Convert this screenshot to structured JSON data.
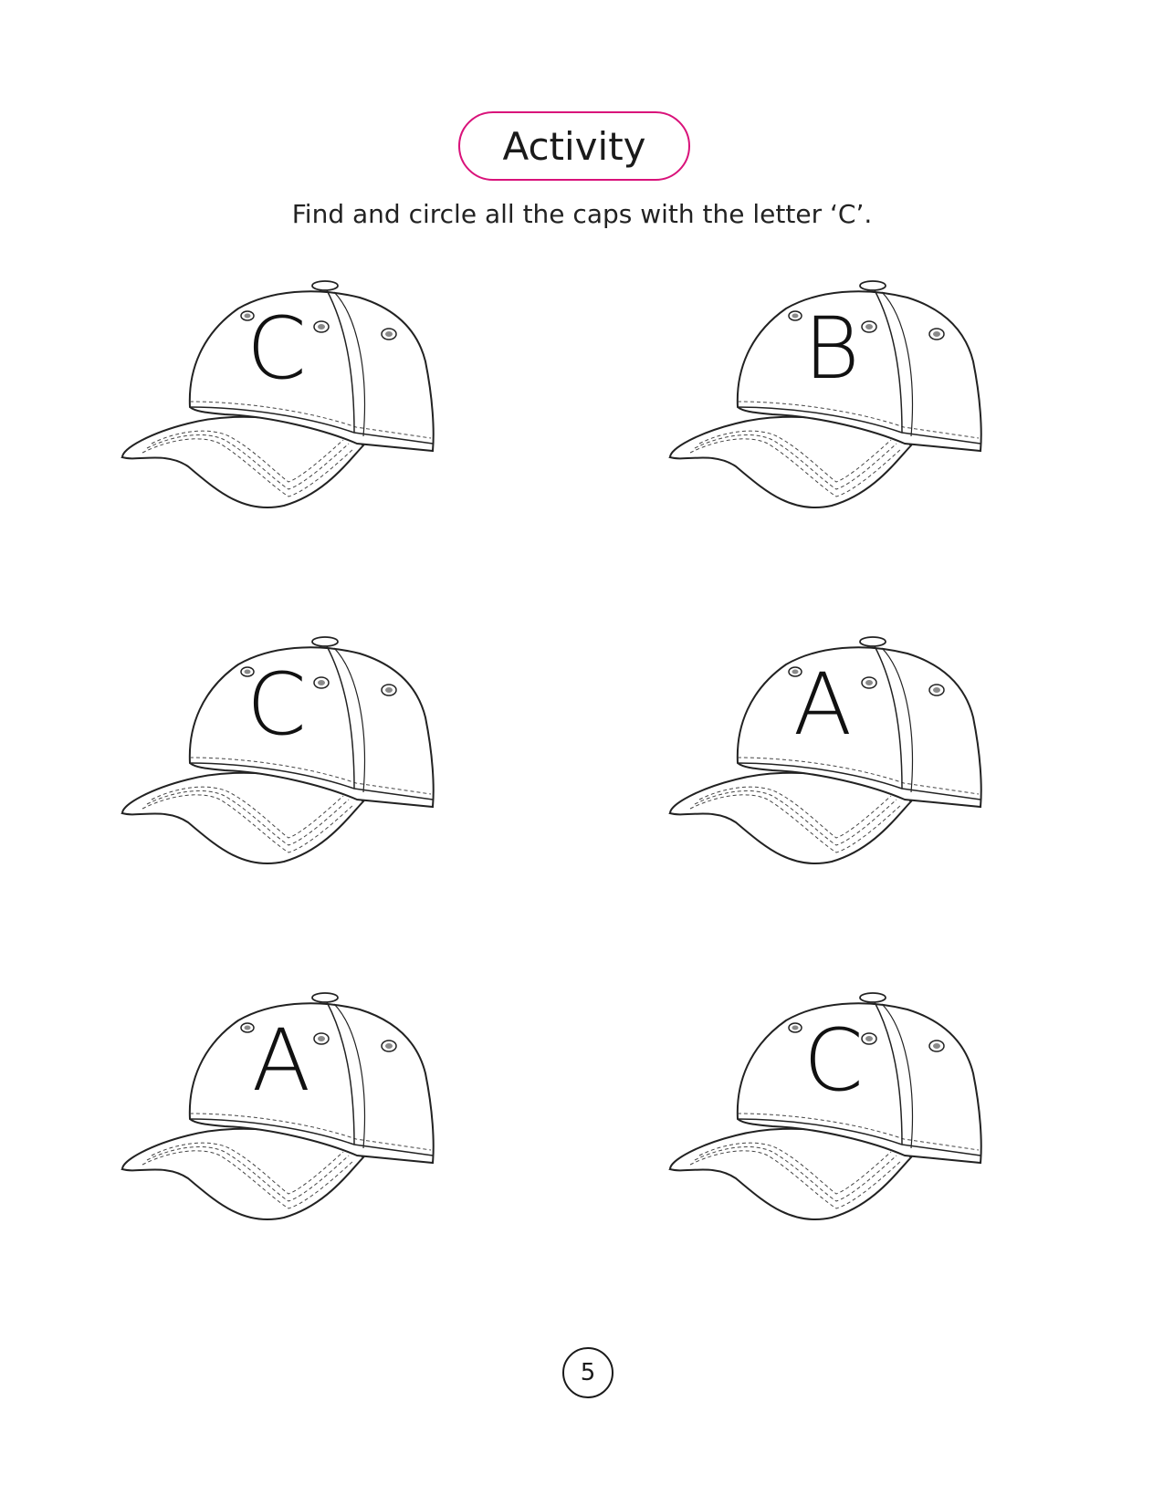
{
  "header": {
    "title": "Activity",
    "instruction": "Find and circle all the caps with the letter ‘C’."
  },
  "caps": [
    {
      "letter": "C"
    },
    {
      "letter": "B"
    },
    {
      "letter": "C"
    },
    {
      "letter": "A"
    },
    {
      "letter": "A"
    },
    {
      "letter": "C"
    }
  ],
  "footer": {
    "page_number": "5"
  },
  "colors": {
    "title_border": "#d9127a",
    "cap_fill": "#ffffff",
    "cap_underbrim": "#cfcfcf",
    "eyelet": "#8a8a8a"
  }
}
